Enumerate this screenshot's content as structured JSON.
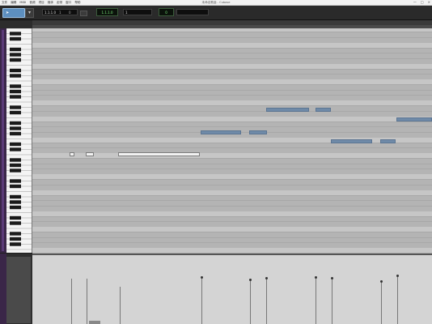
{
  "window": {
    "title": "未命名歌曲 - Cubase",
    "controls": [
      "—",
      "□",
      "×"
    ]
  },
  "menu": [
    "文件",
    "编辑",
    "MIDI",
    "音频",
    "项目",
    "媒体",
    "走带",
    "窗口",
    "帮助"
  ],
  "toolbar": {
    "field_a_main": "1.1.1.0",
    "field_a_sub": "1",
    "field_a_sub2": "0",
    "lcd_1": "1.1.1.0",
    "field_b": "1",
    "lcd_2": "0",
    "field_c": ""
  },
  "piano_roll": {
    "note_color": "#6f8aa8",
    "selected_note_color": "#f2f2f2"
  },
  "velocity": {
    "values": [
      0.66,
      0.66,
      0.54,
      0.68,
      0.64,
      0.66,
      0.68,
      0.66,
      0.62,
      0.7
    ]
  }
}
